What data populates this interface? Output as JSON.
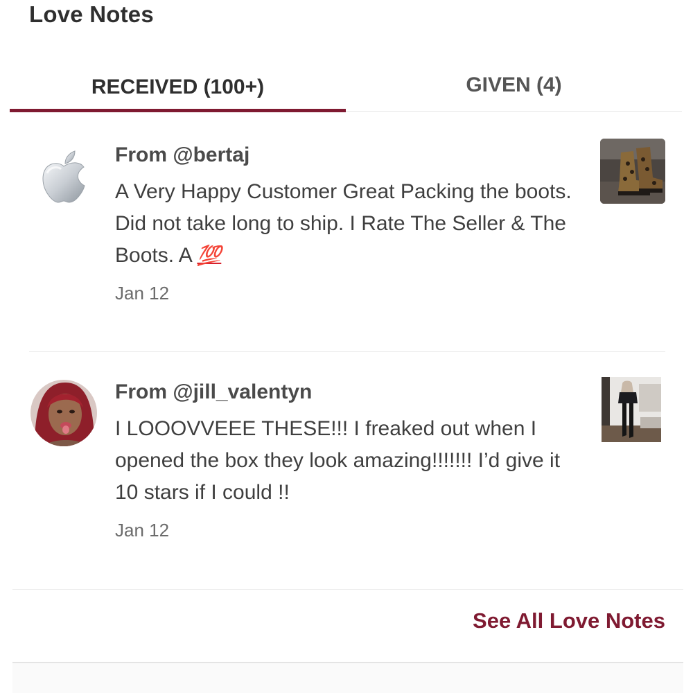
{
  "header": {
    "title": "Love Notes"
  },
  "tabs": [
    {
      "label": "RECEIVED (100+)",
      "active": true
    },
    {
      "label": "GIVEN (4)",
      "active": false
    }
  ],
  "notes": [
    {
      "from": "From @bertaj",
      "body_main": "A Very Happy Customer Great Packing the boots. Did not take long to ship. I Rate The Seller & The Boots. A ",
      "emoji": "💯",
      "date": "Jan 12",
      "avatar_icon": "apple-logo-icon",
      "thumb_icon": "leopard-boots-photo"
    },
    {
      "from": "From @jill_valentyn",
      "body": "I LOOOVVEEE THESE!!! I freaked out when I opened the box they look amazing!!!!!!! I’d give it 10 stars if I could !!",
      "date": "Jan 12",
      "avatar_icon": "user-photo-avatar",
      "thumb_icon": "thigh-high-boots-photo"
    }
  ],
  "footer": {
    "see_all_label": "See All Love Notes"
  },
  "colors": {
    "accent": "#7f1a31",
    "emoji_red": "#d8202b",
    "text_dark": "#2f2f2f",
    "text_muted": "#6b6b6b"
  }
}
